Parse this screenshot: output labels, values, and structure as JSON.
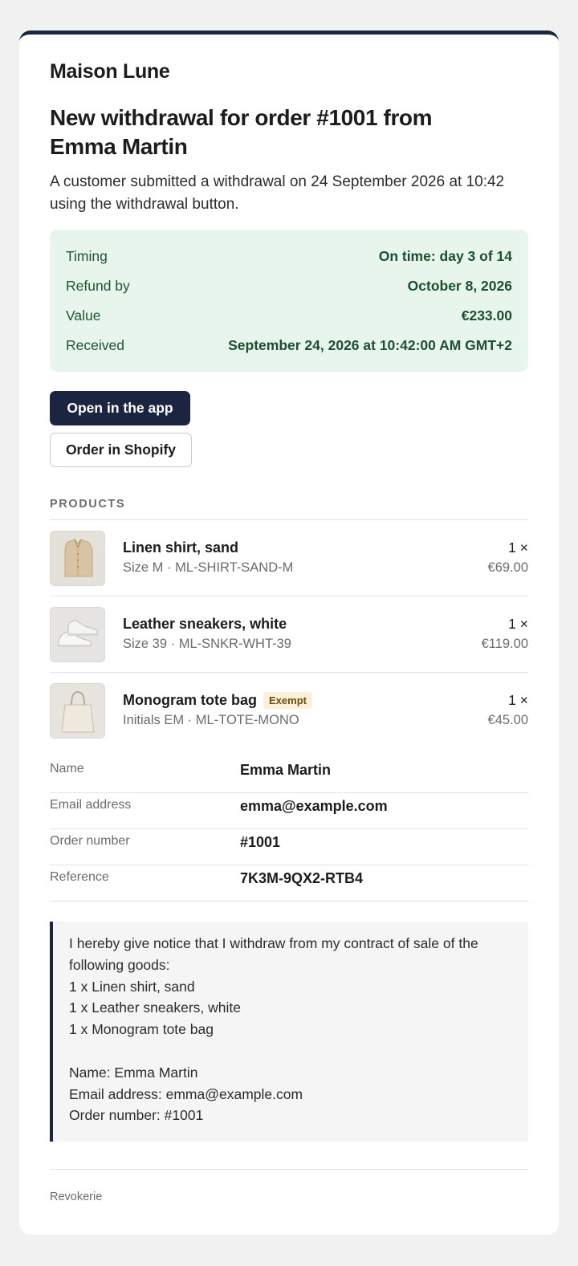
{
  "email": {
    "shop_name": "Maison Lune",
    "headline": "New withdrawal for order #1001 from Emma Martin",
    "intro": "A customer submitted a withdrawal on 24 September 2026 at 10:42 using the withdrawal button.",
    "accent_color": "#1b2540",
    "summary": [
      {
        "label": "Timing",
        "value": "On time: day 3 of 14"
      },
      {
        "label": "Refund by",
        "value": "October 8, 2026"
      },
      {
        "label": "Value",
        "value": "€233.00"
      },
      {
        "label": "Received",
        "value": "September 24, 2026 at 10:42:00 AM GMT+2"
      }
    ],
    "summary_color": "#e8f5ec",
    "buttons": {
      "open_app": "Open in the app",
      "order_shopify": "Order in Shopify"
    },
    "products_label": "PRODUCTS",
    "products": [
      {
        "name": "Linen shirt, sand",
        "details": "Size M · ML-SHIRT-SAND-M",
        "quantity": "1 ×",
        "price": "€69.00",
        "badge": "",
        "image": "shirt-image"
      },
      {
        "name": "Leather sneakers, white",
        "details": "Size 39 · ML-SNKR-WHT-39",
        "quantity": "1 ×",
        "price": "€119.00",
        "badge": "",
        "image": "sneakers-image"
      },
      {
        "name": "Monogram tote bag",
        "details": "Initials EM · ML-TOTE-MONO",
        "quantity": "1 ×",
        "price": "€45.00",
        "badge": "Exempt",
        "image": "tote-bag-image"
      }
    ],
    "customer": [
      {
        "label": "Name",
        "value": "Emma Martin"
      },
      {
        "label": "Email address",
        "value": "emma@example.com"
      },
      {
        "label": "Order number",
        "value": "#1001"
      },
      {
        "label": "Reference",
        "value": "7K3M-9QX2-RTB4"
      }
    ],
    "notice_lines": [
      "I hereby give notice that I withdraw from my contract of sale of the",
      "following goods:",
      "1 x Linen shirt, sand",
      "1 x Leather sneakers, white",
      "1 x Monogram tote bag",
      "",
      "Name: Emma Martin",
      "Email address: emma@example.com",
      "Order number: #1001"
    ],
    "footer": "Revokerie"
  }
}
